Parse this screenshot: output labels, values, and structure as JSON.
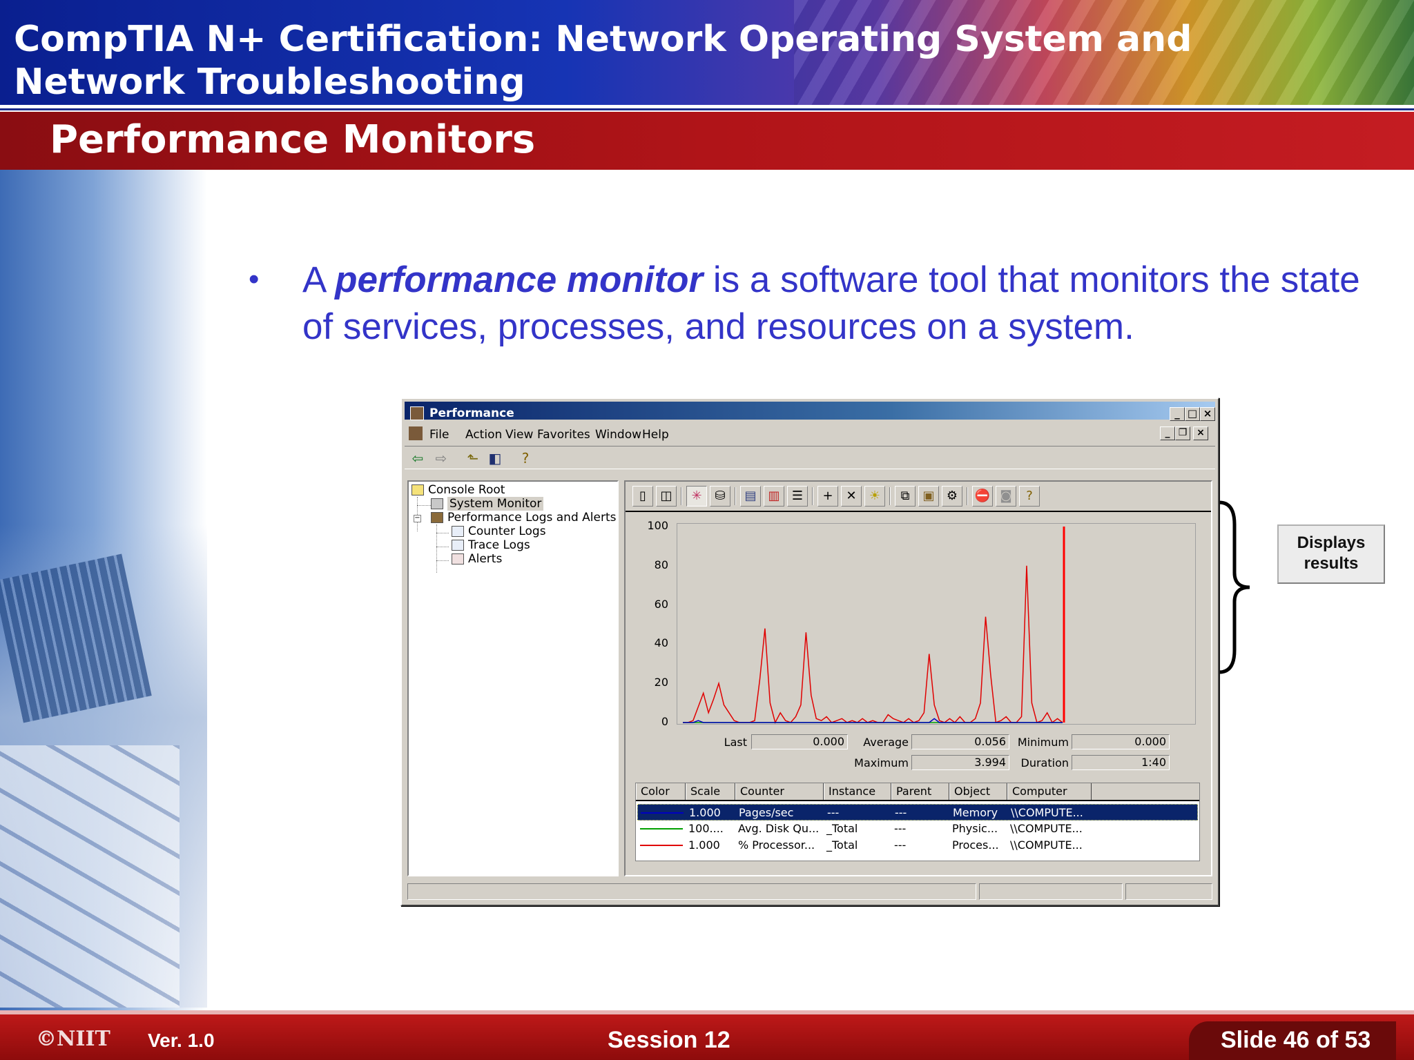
{
  "slide": {
    "header_title": "CompTIA N+ Certification:  Network  Operating System and Network Troubleshooting",
    "section_title": "Performance Monitors",
    "bullet": {
      "prefix": "A ",
      "term": "performance monitor",
      "rest": " is a software tool that monitors the state of services, processes, and resources on a system."
    },
    "callout": "Displays results",
    "footer": {
      "logo": "©NIIT",
      "version": "Ver.  1.0",
      "session": "Session 12",
      "slide": "Slide 46 of 53"
    }
  },
  "window": {
    "title": "Performance",
    "caption_buttons": [
      "_",
      "□",
      "×"
    ],
    "menu": [
      {
        "label": "File"
      },
      {
        "label": "Action"
      },
      {
        "label": "View"
      },
      {
        "label": "Favorites"
      },
      {
        "label": "Window"
      },
      {
        "label": "Help"
      }
    ],
    "tree": {
      "root": "Console Root",
      "system_monitor": "System Monitor",
      "logs_alerts": "Performance Logs and Alerts",
      "counter_logs": "Counter Logs",
      "trace_logs": "Trace Logs",
      "alerts": "Alerts"
    },
    "stats": {
      "last_label": "Last",
      "last_value": "0.000",
      "average_label": "Average",
      "average_value": "0.056",
      "minimum_label": "Minimum",
      "minimum_value": "0.000",
      "maximum_label": "Maximum",
      "maximum_value": "3.994",
      "duration_label": "Duration",
      "duration_value": "1:40"
    },
    "table": {
      "headers": [
        "Color",
        "Scale",
        "Counter",
        "Instance",
        "Parent",
        "Object",
        "Computer"
      ],
      "rows": [
        {
          "scale": "1.000",
          "counter": "Pages/sec",
          "instance": "---",
          "parent": "---",
          "object": "Memory",
          "computer": "\\\\COMPUTE...",
          "color": "#0000c0"
        },
        {
          "scale": "100....",
          "counter": "Avg. Disk Qu...",
          "instance": "_Total",
          "parent": "---",
          "object": "Physic...",
          "computer": "\\\\COMPUTE...",
          "color": "#00a000"
        },
        {
          "scale": "1.000",
          "counter": "% Processor...",
          "instance": "_Total",
          "parent": "---",
          "object": "Proces...",
          "computer": "\\\\COMPUTE...",
          "color": "#e00000"
        }
      ]
    }
  },
  "chart_data": {
    "type": "line",
    "ylim": [
      0,
      100
    ],
    "yticks": [
      "100",
      "80",
      "60",
      "40",
      "20",
      "0"
    ],
    "x": [
      0,
      1,
      2,
      3,
      4,
      5,
      6,
      7,
      8,
      9,
      10,
      11,
      12,
      13,
      14,
      15,
      16,
      17,
      18,
      19,
      20,
      21,
      22,
      23,
      24,
      25,
      26,
      27,
      28,
      29,
      30,
      31,
      32,
      33,
      34,
      35,
      36,
      37,
      38,
      39,
      40,
      41,
      42,
      43,
      44,
      45,
      46,
      47,
      48,
      49,
      50,
      51,
      52,
      53,
      54,
      55,
      56,
      57,
      58,
      59,
      60,
      61,
      62,
      63,
      64,
      65,
      66,
      67,
      68,
      69,
      70,
      71,
      72,
      73,
      74
    ],
    "series": [
      {
        "name": "% Processor...",
        "color": "#e00000",
        "values": [
          0,
          0,
          1,
          8,
          15,
          5,
          12,
          20,
          9,
          5,
          1,
          0,
          0,
          0,
          1,
          22,
          48,
          10,
          0,
          5,
          1,
          0,
          3,
          9,
          46,
          14,
          2,
          1,
          3,
          0,
          1,
          2,
          0,
          1,
          0,
          2,
          0,
          1,
          0,
          0,
          4,
          2,
          1,
          0,
          2,
          0,
          1,
          5,
          35,
          9,
          1,
          0,
          2,
          0,
          3,
          0,
          0,
          2,
          10,
          54,
          24,
          0,
          1,
          3,
          0,
          0,
          3,
          80,
          10,
          0,
          1,
          5,
          0,
          2,
          0
        ]
      },
      {
        "name": "Avg. Disk Qu...",
        "color": "#00a000",
        "values": [
          0,
          0,
          0,
          0,
          0,
          0,
          0,
          0,
          0,
          0,
          0,
          0,
          0,
          0,
          0,
          0,
          0,
          0,
          0,
          0,
          0,
          0,
          0,
          0,
          0,
          0,
          0,
          0,
          0,
          0,
          0,
          0,
          0,
          0,
          0,
          0,
          0,
          0,
          0,
          0,
          0,
          0,
          0,
          0,
          0,
          0,
          0,
          0,
          0,
          0,
          0,
          0,
          0,
          0,
          0,
          0,
          0,
          0,
          0,
          0,
          0,
          0,
          0,
          0,
          0,
          0,
          0,
          0,
          0,
          0,
          0,
          0,
          0,
          0,
          0
        ]
      },
      {
        "name": "Pages/sec",
        "color": "#0000c0",
        "values": [
          0,
          0,
          0,
          1,
          0,
          0,
          0,
          0,
          0,
          0,
          0,
          0,
          0,
          0,
          0,
          0,
          0,
          0,
          0,
          0,
          0,
          0,
          0,
          0,
          0,
          0,
          0,
          0,
          0,
          0,
          0,
          0,
          0,
          0,
          0,
          0,
          0,
          0,
          0,
          0,
          0,
          0,
          0,
          0,
          0,
          0,
          0,
          0,
          0,
          2,
          0,
          0,
          0,
          0,
          0,
          0,
          0,
          0,
          0,
          0,
          0,
          0,
          0,
          0,
          0,
          0,
          0,
          0,
          0,
          0,
          0,
          0,
          0,
          0,
          0
        ]
      }
    ],
    "time_bar_index": 74
  }
}
